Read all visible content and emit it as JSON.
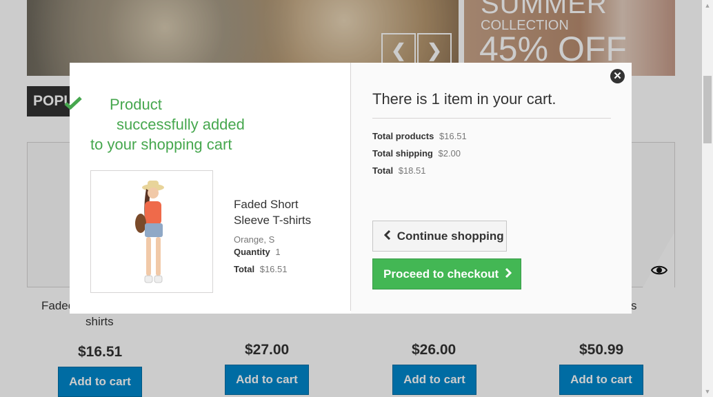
{
  "banner": {
    "prev_arrow": "❮",
    "next_arrow": "❯",
    "promo_line1": "SUMMER",
    "promo_line2": "COLLECTION",
    "promo_line3": "45% OFF"
  },
  "section_tab": "POPU",
  "products": [
    {
      "name_visible": "Fadec",
      "name_line2": "shirts",
      "price": "$16.51",
      "button": "Add to cart"
    },
    {
      "price": "$27.00",
      "button": "Add to cart"
    },
    {
      "price": "$26.00",
      "button": "Add to cart"
    },
    {
      "name_visible": "s",
      "price": "$50.99",
      "button": "Add to cart"
    }
  ],
  "icons": {
    "check": "check-icon",
    "close": "close-icon",
    "eye": "eye-icon",
    "chevron_left": "chevron-left-icon",
    "chevron_right": "chevron-right-icon"
  },
  "modal": {
    "success_line1": "Product",
    "success_line2": "successfully added",
    "success_line3": "to your shopping cart",
    "item": {
      "name": "Faded Short Sleeve T-shirts",
      "attributes": "Orange, S",
      "quantity_label": "Quantity",
      "quantity": "1",
      "total_label": "Total",
      "total": "$16.51"
    },
    "cart_title": "There is 1 item in your cart.",
    "summary": {
      "products_label": "Total products",
      "products_value": "$16.51",
      "shipping_label": "Total shipping",
      "shipping_value": "$2.00",
      "total_label": "Total",
      "total_value": "$18.51"
    },
    "continue_label": "Continue shopping",
    "checkout_label": "Proceed to checkout",
    "close_glyph": "✕"
  },
  "colors": {
    "success_green": "#46a74e",
    "checkout_green": "#43b754",
    "cart_blue": "#0088cc"
  }
}
